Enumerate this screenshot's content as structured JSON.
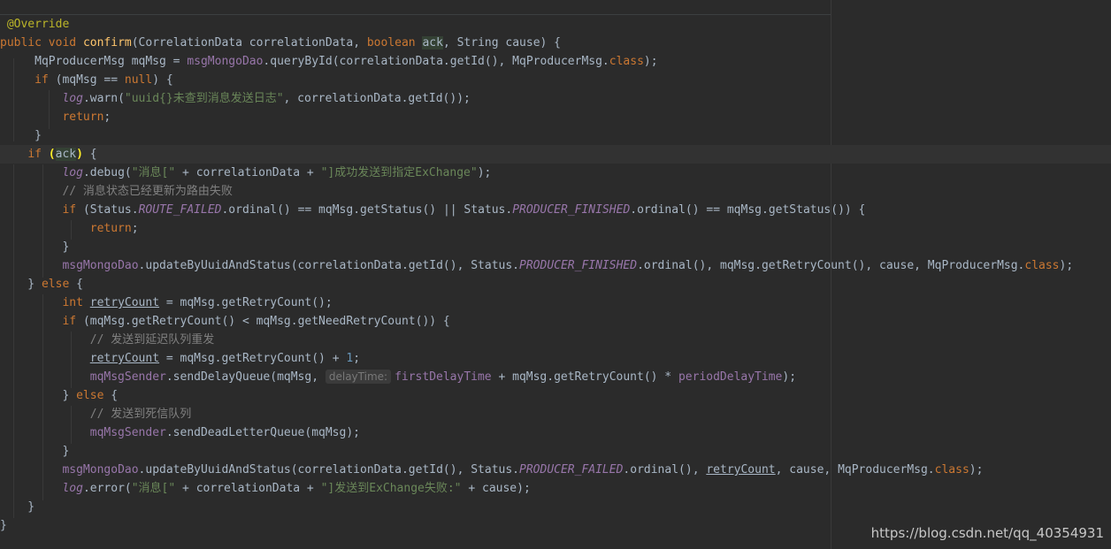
{
  "colors": {
    "background": "#2b2b2b",
    "keyword": "#cc7832",
    "method": "#ffc66d",
    "string": "#6a8759",
    "field": "#9876aa",
    "number": "#6897bb",
    "comment": "#808080",
    "annotation": "#bbb529",
    "plain": "#a9b7c6"
  },
  "watermark": "https://blog.csdn.net/qq_40354931",
  "code_lines": [
    [
      [
        "ann",
        " @Override"
      ]
    ],
    [
      [
        "kw",
        "public "
      ],
      [
        "kw",
        "void "
      ],
      [
        "fn",
        "confirm"
      ],
      [
        "pl",
        "(CorrelationData correlationData, "
      ],
      [
        "kw",
        "boolean "
      ],
      [
        "hl",
        "ack"
      ],
      [
        "pl",
        ", String cause) {"
      ]
    ],
    [
      [
        "pl",
        "     MqProducerMsg mqMsg = "
      ],
      [
        "fld",
        "msgMongoDao"
      ],
      [
        "pl",
        ".queryById(correlationData.getId(), MqProducerMsg."
      ],
      [
        "kw",
        "class"
      ],
      [
        "pl",
        ");"
      ]
    ],
    [
      [
        "pl",
        "     "
      ],
      [
        "kw",
        "if "
      ],
      [
        "pl",
        "(mqMsg == "
      ],
      [
        "kw",
        "null"
      ],
      [
        "pl",
        ") {"
      ]
    ],
    [
      [
        "pl",
        "         "
      ],
      [
        "lg",
        "log"
      ],
      [
        "pl",
        ".warn("
      ],
      [
        "str",
        "\"uuid{}未查到消息发送日志\""
      ],
      [
        "pl",
        ", correlationData.getId());"
      ]
    ],
    [
      [
        "pl",
        "         "
      ],
      [
        "kw",
        "return"
      ],
      [
        "pl",
        ";"
      ]
    ],
    [
      [
        "pl",
        "     }"
      ]
    ],
    [
      [
        "pl",
        "    "
      ],
      [
        "kw",
        "if "
      ],
      [
        "br",
        "("
      ],
      [
        "hl",
        "ack"
      ],
      [
        "br",
        ")"
      ],
      [
        "pl",
        " {"
      ]
    ],
    [
      [
        "pl",
        "         "
      ],
      [
        "lg",
        "log"
      ],
      [
        "pl",
        ".debug("
      ],
      [
        "str",
        "\"消息[\""
      ],
      [
        "pl",
        " + correlationData + "
      ],
      [
        "str",
        "\"]成功发送到指定ExChange\""
      ],
      [
        "pl",
        ");"
      ]
    ],
    [
      [
        "pl",
        "         "
      ],
      [
        "cmt",
        "// 消息状态已经更新为路由失败"
      ]
    ],
    [
      [
        "pl",
        "         "
      ],
      [
        "kw",
        "if "
      ],
      [
        "pl",
        "(Status."
      ],
      [
        "cst",
        "ROUTE_FAILED"
      ],
      [
        "pl",
        ".ordinal() == mqMsg.getStatus() || Status."
      ],
      [
        "cst",
        "PRODUCER_FINISHED"
      ],
      [
        "pl",
        ".ordinal() == mqMsg.getStatus()) {"
      ]
    ],
    [
      [
        "pl",
        "             "
      ],
      [
        "kw",
        "return"
      ],
      [
        "pl",
        ";"
      ]
    ],
    [
      [
        "pl",
        "         }"
      ]
    ],
    [
      [
        "pl",
        "         "
      ],
      [
        "fld",
        "msgMongoDao"
      ],
      [
        "pl",
        ".updateByUuidAndStatus(correlationData.getId(), Status."
      ],
      [
        "cst",
        "PRODUCER_FINISHED"
      ],
      [
        "pl",
        ".ordinal(), mqMsg.getRetryCount(), cause, MqProducerMsg."
      ],
      [
        "kw",
        "class"
      ],
      [
        "pl",
        ");"
      ]
    ],
    [
      [
        "pl",
        "    } "
      ],
      [
        "kw",
        "else "
      ],
      [
        "pl",
        "{"
      ]
    ],
    [
      [
        "pl",
        "         "
      ],
      [
        "kw",
        "int "
      ],
      [
        "var",
        "retryCount"
      ],
      [
        "pl",
        " = mqMsg.getRetryCount();"
      ]
    ],
    [
      [
        "pl",
        "         "
      ],
      [
        "kw",
        "if "
      ],
      [
        "pl",
        "(mqMsg.getRetryCount() < mqMsg.getNeedRetryCount()) {"
      ]
    ],
    [
      [
        "pl",
        "             "
      ],
      [
        "cmt",
        "// 发送到延迟队列重发"
      ]
    ],
    [
      [
        "pl",
        "             "
      ],
      [
        "var",
        "retryCount"
      ],
      [
        "pl",
        " = mqMsg.getRetryCount() + "
      ],
      [
        "num",
        "1"
      ],
      [
        "pl",
        ";"
      ]
    ],
    [
      [
        "pl",
        "             "
      ],
      [
        "fld",
        "mqMsgSender"
      ],
      [
        "pl",
        ".sendDelayQueue(mqMsg, "
      ],
      [
        "hint",
        "delayTime:"
      ],
      [
        "fld",
        "firstDelayTime"
      ],
      [
        "pl",
        " + mqMsg.getRetryCount() * "
      ],
      [
        "fld",
        "periodDelayTime"
      ],
      [
        "pl",
        ");"
      ]
    ],
    [
      [
        "pl",
        "         } "
      ],
      [
        "kw",
        "else "
      ],
      [
        "pl",
        "{"
      ]
    ],
    [
      [
        "pl",
        "             "
      ],
      [
        "cmt",
        "// 发送到死信队列"
      ]
    ],
    [
      [
        "pl",
        "             "
      ],
      [
        "fld",
        "mqMsgSender"
      ],
      [
        "pl",
        ".sendDeadLetterQueue(mqMsg);"
      ]
    ],
    [
      [
        "pl",
        "         }"
      ]
    ],
    [
      [
        "pl",
        "         "
      ],
      [
        "fld",
        "msgMongoDao"
      ],
      [
        "pl",
        ".updateByUuidAndStatus(correlationData.getId(), Status."
      ],
      [
        "cst",
        "PRODUCER_FAILED"
      ],
      [
        "pl",
        ".ordinal(), "
      ],
      [
        "var",
        "retryCount"
      ],
      [
        "pl",
        ", cause, MqProducerMsg."
      ],
      [
        "kw",
        "class"
      ],
      [
        "pl",
        ");"
      ]
    ],
    [
      [
        "pl",
        "         "
      ],
      [
        "lg",
        "log"
      ],
      [
        "pl",
        ".error("
      ],
      [
        "str",
        "\"消息[\""
      ],
      [
        "pl",
        " + correlationData + "
      ],
      [
        "str",
        "\"]发送到ExChange失败:\""
      ],
      [
        "pl",
        " + cause);"
      ]
    ],
    [
      [
        "pl",
        "    }"
      ]
    ],
    [
      [
        "pl",
        "}"
      ]
    ]
  ]
}
